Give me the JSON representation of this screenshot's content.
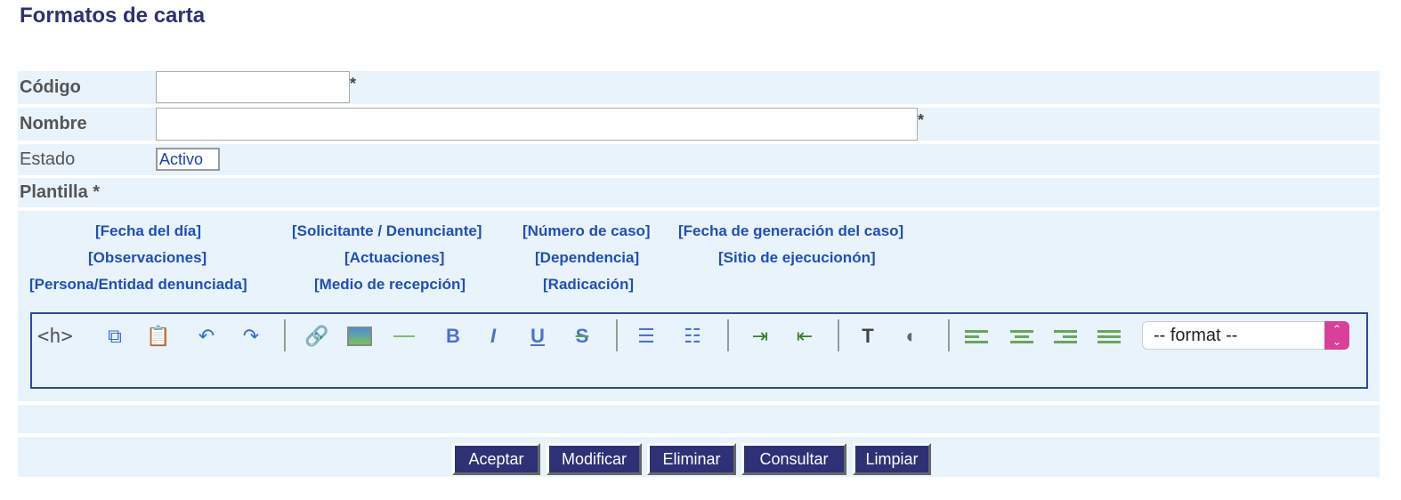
{
  "title": "Formatos de carta",
  "fields": {
    "codigo": {
      "label": "Código",
      "value": "",
      "required": "*"
    },
    "nombre": {
      "label": "Nombre",
      "value": "",
      "required": "*"
    },
    "estado": {
      "label": "Estado",
      "value": "Activo"
    },
    "plantilla": {
      "label": "Plantilla *"
    }
  },
  "placeholders": [
    "[Fecha del día]",
    "[Solicitante / Denunciante]",
    "[Número de caso]",
    "[Fecha de generación del caso]",
    "[Observaciones]",
    "[Actuaciones]",
    "[Dependencia]",
    "[Sitio de ejecucionón]",
    "[Persona/Entidad denunciada]",
    "[Medio de recepción]",
    "[Radicación]"
  ],
  "editor": {
    "heading_label": "<h>",
    "format_select": "-- format --",
    "format_arrows": "⌃⌄"
  },
  "buttons": {
    "aceptar": "Aceptar",
    "modificar": "Modificar",
    "eliminar": "Eliminar",
    "consultar": "Consultar",
    "limpiar": "Limpiar"
  }
}
